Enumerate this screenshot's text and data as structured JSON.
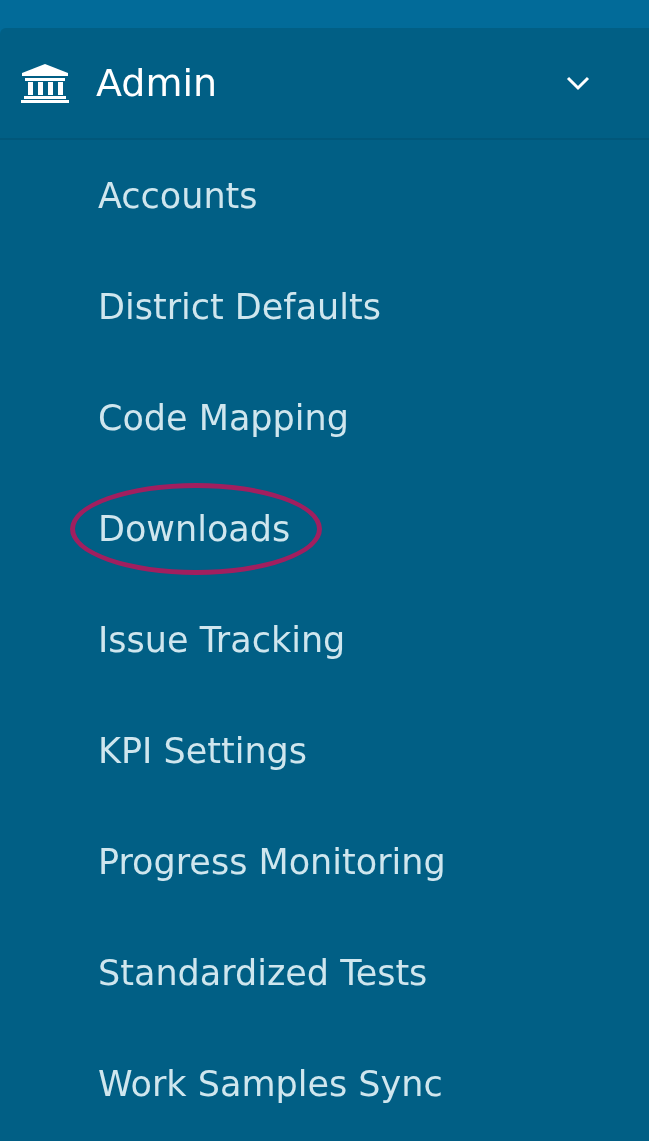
{
  "section": {
    "title": "Admin",
    "expanded": true
  },
  "items": [
    {
      "label": "Accounts",
      "circled": false
    },
    {
      "label": "District Defaults",
      "circled": false
    },
    {
      "label": "Code Mapping",
      "circled": false
    },
    {
      "label": "Downloads",
      "circled": true
    },
    {
      "label": "Issue Tracking",
      "circled": false
    },
    {
      "label": "KPI Settings",
      "circled": false
    },
    {
      "label": "Progress Monitoring",
      "circled": false
    },
    {
      "label": "Standardized Tests",
      "circled": false
    },
    {
      "label": "Work Samples Sync",
      "circled": false
    }
  ]
}
